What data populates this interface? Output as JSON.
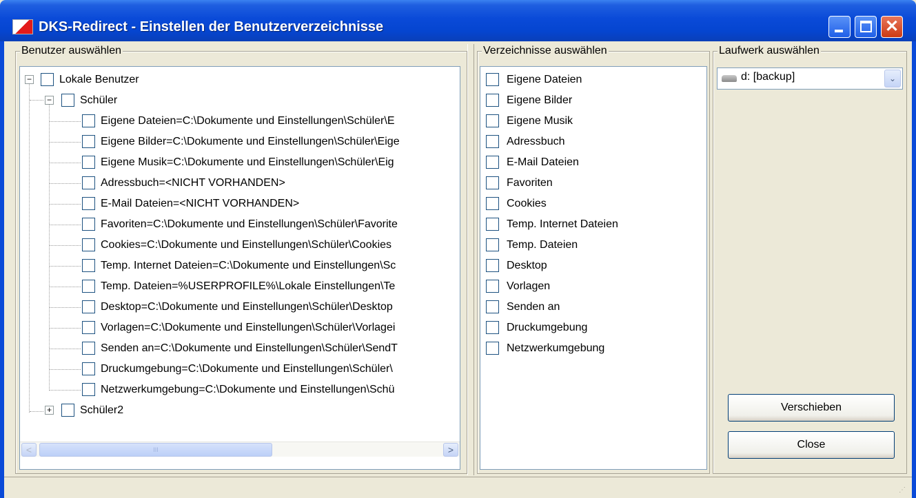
{
  "window": {
    "title": "DKS-Redirect - Einstellen der Benutzerverzeichnisse",
    "close_glyph": "✕"
  },
  "users": {
    "group_label": "Benutzer auswählen",
    "root": {
      "label": "Lokale Benutzer",
      "expander": "−"
    },
    "user1": {
      "label": "Schüler",
      "expander": "−"
    },
    "items": [
      "Eigene Dateien=C:\\Dokumente und Einstellungen\\Schüler\\E",
      "Eigene Bilder=C:\\Dokumente und Einstellungen\\Schüler\\Eige",
      "Eigene Musik=C:\\Dokumente und Einstellungen\\Schüler\\Eig",
      "Adressbuch=<NICHT VORHANDEN>",
      "E-Mail Dateien=<NICHT VORHANDEN>",
      "Favoriten=C:\\Dokumente und Einstellungen\\Schüler\\Favorite",
      "Cookies=C:\\Dokumente und Einstellungen\\Schüler\\Cookies",
      "Temp. Internet Dateien=C:\\Dokumente und Einstellungen\\Sc",
      "Temp. Dateien=%USERPROFILE%\\Lokale Einstellungen\\Te",
      "Desktop=C:\\Dokumente und Einstellungen\\Schüler\\Desktop",
      "Vorlagen=C:\\Dokumente und Einstellungen\\Schüler\\Vorlagei",
      "Senden an=C:\\Dokumente und Einstellungen\\Schüler\\SendT",
      "Druckumgebung=C:\\Dokumente und Einstellungen\\Schüler\\",
      "Netzwerkumgebung=C:\\Dokumente und Einstellungen\\Schü"
    ],
    "user2": {
      "label": "Schüler2",
      "expander": "+"
    },
    "scroll": {
      "left_arrow": "<",
      "right_arrow": ">",
      "thumb_grip": "III"
    }
  },
  "folders": {
    "group_label": "Verzeichnisse auswählen",
    "items": [
      "Eigene Dateien",
      "Eigene Bilder",
      "Eigene Musik",
      "Adressbuch",
      "E-Mail Dateien",
      "Favoriten",
      "Cookies",
      "Temp. Internet Dateien",
      "Temp. Dateien",
      "Desktop",
      "Vorlagen",
      "Senden an",
      "Druckumgebung",
      "Netzwerkumgebung"
    ]
  },
  "drive": {
    "group_label": "Laufwerk auswählen",
    "selected": "d: [backup]",
    "icon": "drive-icon",
    "arrow": "⌄"
  },
  "buttons": {
    "move": "Verschieben",
    "close": "Close"
  },
  "statusbar": {
    "grip": "⋰"
  }
}
